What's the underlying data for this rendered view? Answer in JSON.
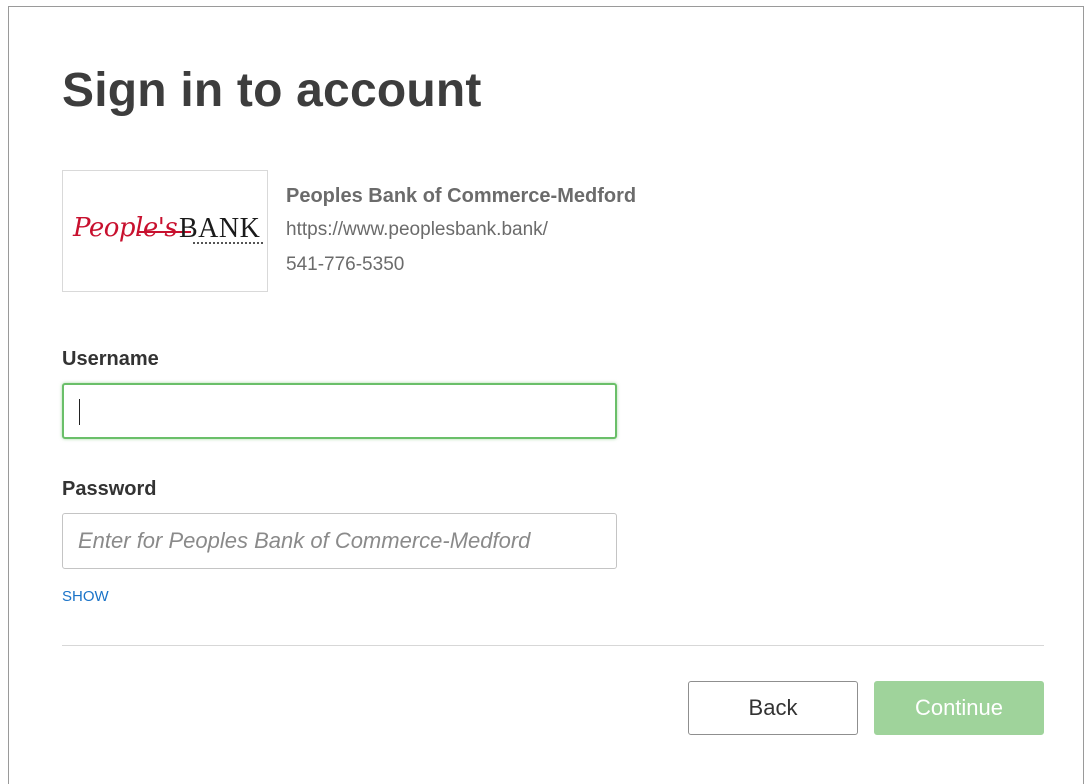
{
  "page": {
    "title": "Sign in to account"
  },
  "institution": {
    "logo_text_script": "People's",
    "logo_text_bank": "BANK",
    "name": "Peoples Bank of Commerce-Medford",
    "url": "https://www.peoplesbank.bank/",
    "phone": "541-776-5350",
    "brand_color": "#c8102e"
  },
  "form": {
    "username_label": "Username",
    "username_value": "",
    "password_label": "Password",
    "password_value": "",
    "password_placeholder": "Enter for Peoples Bank of Commerce-Medford",
    "show_label": "SHOW",
    "focus_color": "#6abf69",
    "link_color": "#1a73c8"
  },
  "actions": {
    "back_label": "Back",
    "continue_label": "Continue",
    "continue_color": "#9fd39b"
  }
}
